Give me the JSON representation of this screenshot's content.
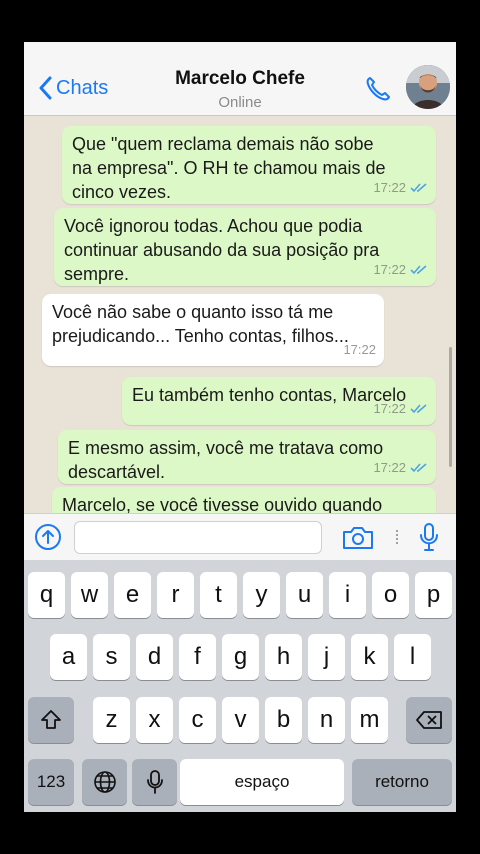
{
  "header": {
    "back_label": "Chats",
    "contact_name": "Marcelo Chefe",
    "contact_status": "Online"
  },
  "messages": [
    {
      "direction": "out",
      "lines": [
        "Que \"quem reclama demais não sobe",
        "na empresa\". O RH te chamou mais de",
        "cinco vezes."
      ],
      "time": "17:22",
      "read": true
    },
    {
      "direction": "out",
      "lines": [
        "Você ignorou todas. Achou que podia",
        "continuar abusando da sua posição pra",
        "sempre."
      ],
      "time": "17:22",
      "read": true
    },
    {
      "direction": "in",
      "lines": [
        "Você não sabe o quanto isso tá me",
        "prejudicando... Tenho contas, filhos..."
      ],
      "time": "17:22"
    },
    {
      "direction": "out",
      "lines": [
        "Eu também tenho contas, Marcelo"
      ],
      "time": "17:22",
      "read": true
    },
    {
      "direction": "out",
      "lines": [
        "E mesmo assim, você me tratava como",
        "descartável."
      ],
      "time": "17:22",
      "read": true
    },
    {
      "direction": "out",
      "lines": [
        "Marcelo, se você tivesse ouvido quando"
      ],
      "time": ""
    }
  ],
  "input": {
    "value": "",
    "placeholder": ""
  },
  "keyboard": {
    "row1": [
      "q",
      "w",
      "e",
      "r",
      "t",
      "y",
      "u",
      "i",
      "o",
      "p"
    ],
    "row2": [
      "a",
      "s",
      "d",
      "f",
      "g",
      "h",
      "j",
      "k",
      "l"
    ],
    "row3": [
      "z",
      "x",
      "c",
      "v",
      "b",
      "n",
      "m"
    ],
    "numbers_label": "123",
    "space_label": "espaço",
    "return_label": "retorno"
  },
  "colors": {
    "accent": "#1b7af2",
    "outgoing_bubble": "#dcf8c6",
    "incoming_bubble": "#ffffff",
    "read_ticks": "#4fa3e6"
  },
  "icons": [
    "chevron-left-icon",
    "phone-icon",
    "upload-icon",
    "camera-icon",
    "microphone-icon",
    "shift-icon",
    "backspace-icon",
    "globe-icon"
  ]
}
